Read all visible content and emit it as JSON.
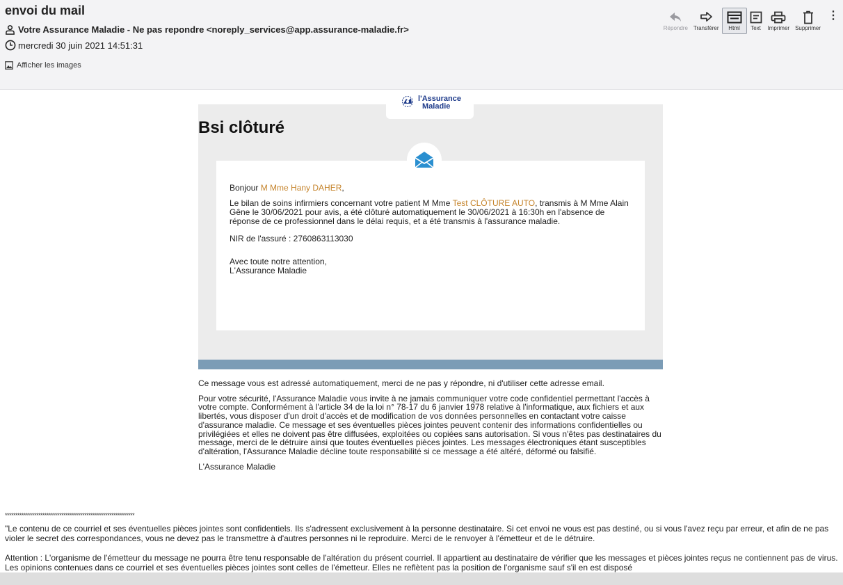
{
  "header": {
    "subject": "envoi du mail",
    "from": "Votre Assurance Maladie - Ne pas repondre <noreply_services@app.assurance-maladie.fr>",
    "date": "mercredi 30 juin 2021 14:51:31",
    "show_images": "Afficher les images"
  },
  "toolbar": {
    "reply": "Répondre",
    "forward": "Transférer",
    "html": "Html",
    "text": "Text",
    "print": "Imprimer",
    "delete": "Supprimer",
    "more": "⋮"
  },
  "email": {
    "logo_line1": "l'Assurance",
    "logo_line2": "Maladie",
    "title": "Bsi clôturé",
    "greeting_prefix": "Bonjour ",
    "greeting_name": "M Mme Hany DAHER",
    "greeting_suffix": ",",
    "body_1": "Le bilan de soins infirmiers concernant votre patient M Mme ",
    "patient_name": "Test CLÔTURE AUTO",
    "body_2": ", transmis à M Mme Alain Gêne le 30/06/2021 pour avis, a été clôturé automatiquement le 30/06/2021 à 16:30h en l'absence de réponse de ce professionnel dans le délai requis, et a été transmis à l'assurance maladie.",
    "nir": "NIR de l'assuré : 2760863113030",
    "closing_1": "Avec toute notre attention,",
    "closing_2": "L'Assurance Maladie",
    "notice_1": "Ce message vous est adressé automatiquement, merci de ne pas y répondre, ni d'utiliser cette adresse email.",
    "notice_2": "Pour votre sécurité, l'Assurance Maladie vous invite à ne jamais communiquer votre code confidentiel permettant l'accès à votre compte. Conformément à l'article 34 de la loi n° 78-17 du 6 janvier 1978 relative à l'informatique, aux fichiers et aux libertés, vous disposer d'un droit d'accès et de modification de vos données personnelles en contactant votre caisse d'assurance maladie. Ce message et ses éventuelles pièces jointes peuvent contenir des informations confidentielles ou privilégiées et elles ne doivent pas être diffusées, exploitées ou copiées sans autorisation. Si vous n'êtes pas destinataires du message, merci de le détruire ainsi que toutes éventuelles pièces jointes. Les messages électroniques étant susceptibles d'altération, l'Assurance Maladie décline toute responsabilité si ce message a été altéré, déformé ou falsifié.",
    "notice_sign": "L'Assurance Maladie"
  },
  "footer": {
    "stars": "**************************************************************",
    "disclaimer_1": "\"Le contenu de ce courriel et ses éventuelles pièces jointes sont confidentiels. Ils s'adressent exclusivement à la personne destinataire. Si cet envoi ne vous est pas destiné, ou si vous l'avez reçu par erreur, et afin de ne pas violer le secret des correspondances, vous ne devez pas le transmettre à d'autres personnes ni le reproduire. Merci de le renvoyer à l'émetteur et de le détruire.",
    "disclaimer_2": "Attention : L'organisme de l'émetteur du message ne pourra être tenu responsable de l'altération du présent courriel. Il appartient au destinataire de vérifier que les messages et pièces jointes reçus ne contiennent pas de virus. Les opinions contenues dans ce courriel et ses éventuelles pièces jointes sont celles de l'émetteur. Elles ne reflètent pas la position de l'organisme sauf s'il en est disposé"
  },
  "colors": {
    "accent_name": "#c5842c",
    "blue_bar": "#7b9cb6",
    "logo_blue": "#1d3a8a",
    "envelope_blue": "#2a8fd0"
  },
  "icons": {
    "from": "person-icon",
    "date": "clock-icon",
    "images": "image-icon",
    "reply": "reply-arrow-icon",
    "forward": "forward-arrow-icon",
    "html": "html-view-icon",
    "text": "text-view-icon",
    "print": "printer-icon",
    "delete": "trash-icon",
    "email": "envelope-icon"
  }
}
